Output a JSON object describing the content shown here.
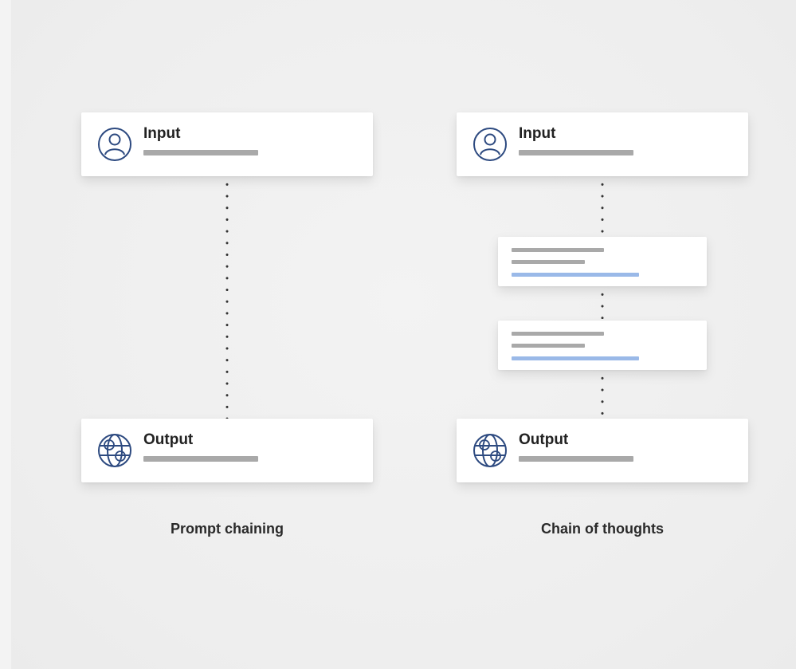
{
  "colors": {
    "background": "#eeeeee",
    "card": "#ffffff",
    "placeholder_line": "#a9a9a9",
    "highlight_line": "#9ab9e8",
    "icon_stroke": "#2d4a80",
    "text": "#222222"
  },
  "left_diagram": {
    "input": {
      "title": "Input",
      "icon": "user-icon"
    },
    "output": {
      "title": "Output",
      "icon": "globe-icon"
    },
    "caption": "Prompt chaining"
  },
  "right_diagram": {
    "input": {
      "title": "Input",
      "icon": "user-icon"
    },
    "steps": [
      {
        "line_colors": [
          "placeholder_line",
          "placeholder_line",
          "highlight_line"
        ]
      },
      {
        "line_colors": [
          "placeholder_line",
          "placeholder_line",
          "highlight_line"
        ]
      }
    ],
    "output": {
      "title": "Output",
      "icon": "globe-icon"
    },
    "caption": "Chain of thoughts"
  }
}
